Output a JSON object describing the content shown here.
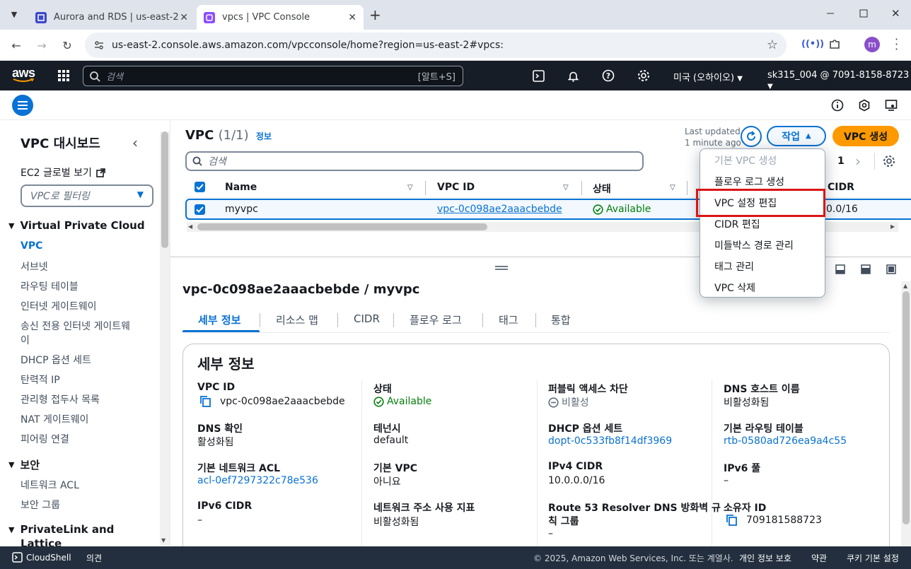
{
  "browser": {
    "tabs": [
      {
        "title": "Aurora and RDS | us-east-2",
        "active": false
      },
      {
        "title": "vpcs | VPC Console",
        "active": true
      }
    ],
    "url": "us-east-2.console.aws.amazon.com/vpcconsole/home?region=us-east-2#vpcs:",
    "profile_initial": "m"
  },
  "aws_bar": {
    "logo": "aws",
    "search_placeholder": "검색",
    "search_shortcut": "[알트+S]",
    "region": "미국 (오하이오)",
    "account": "sk315_004 @ 7091-8158-8723"
  },
  "sidebar": {
    "title": "VPC 대시보드",
    "ec2_global": "EC2 글로벌 보기",
    "filter_placeholder": "VPC로 필터링",
    "section_vpc": "Virtual Private Cloud",
    "vpc_items": [
      "VPC",
      "서브넷",
      "라우팅 테이블",
      "인터넷 게이트웨이",
      "송신 전용 인터넷 게이트웨",
      "이",
      "DHCP 옵션 세트",
      "탄력적 IP",
      "관리형 접두사 목록",
      "NAT 게이트웨이",
      "피어링 연결"
    ],
    "section_security": "보안",
    "security_items": [
      "네트워크 ACL",
      "보안 그룹"
    ],
    "section_privatelink": "PrivateLink and",
    "section_privatelink_2": "Lattice"
  },
  "main": {
    "title": "VPC",
    "count": "(1/1)",
    "info": "정보",
    "last_updated_1": "Last updated",
    "last_updated_2": "1 minute ago",
    "actions": "작업",
    "create": "VPC 생성",
    "search_placeholder": "검색",
    "page": "1",
    "columns": [
      "Name",
      "VPC ID",
      "상태",
      "CIDR"
    ],
    "row": {
      "name": "myvpc",
      "vpc_id": "vpc-0c098ae2aaacbebde",
      "status": "Available",
      "cidr": "0.0/16"
    }
  },
  "dropdown": {
    "items": [
      "기본 VPC 생성",
      "플로우 로그 생성",
      "VPC 설정 편집",
      "CIDR 편집",
      "미들박스 경로 관리",
      "태그 관리",
      "VPC 삭제"
    ],
    "highlighted": "VPC 설정 편집"
  },
  "detail": {
    "title": "vpc-0c098ae2aaacbebde / myvpc",
    "tabs": [
      "세부 정보",
      "리소스 맵",
      "CIDR",
      "플로우 로그",
      "태그",
      "통합"
    ],
    "section_title": "세부 정보",
    "fields": {
      "vpc_id_label": "VPC ID",
      "vpc_id": "vpc-0c098ae2aaacbebde",
      "state_label": "상태",
      "state": "Available",
      "public_block_label": "퍼블릭 액세스 차단",
      "public_block": "비활성",
      "dns_host_label": "DNS 호스트 이름",
      "dns_host": "비활성화됨",
      "dns_res_label": "DNS 확인",
      "dns_res": "활성화됨",
      "tenancy_label": "테넌시",
      "tenancy": "default",
      "dhcp_label": "DHCP 옵션 세트",
      "dhcp": "dopt-0c533fb8f14df3969",
      "main_rt_label": "기본 라우팅 테이블",
      "main_rt": "rtb-0580ad726ea9a4c55",
      "acl_label": "기본 네트워크 ACL",
      "acl": "acl-0ef7297322c78e536",
      "default_vpc_label": "기본 VPC",
      "default_vpc": "아니요",
      "ipv4_label": "IPv4 CIDR",
      "ipv4": "10.0.0.0/16",
      "ipv6pool_label": "IPv6 풀",
      "ipv6pool": "–",
      "ipv6_label": "IPv6 CIDR",
      "ipv6": "–",
      "netaddr_label": "네트워크 주소 사용 지표",
      "netaddr": "비활성화됨",
      "r53_label_1": "Route 53 Resolver DNS 방화벽 규",
      "r53_label_2": "칙 그룹",
      "r53": "–",
      "owner_label": "소유자 ID",
      "owner": "709181588723"
    }
  },
  "footer": {
    "cloudshell": "CloudShell",
    "feedback": "의견",
    "copyright": "© 2025, Amazon Web Services, Inc. 또는 계열사.",
    "privacy": "개인 정보 보호",
    "terms": "약관",
    "cookies": "쿠키 기본 설정"
  },
  "colors": {
    "accent": "#0972d3",
    "orange": "#ff9900",
    "success": "#037f0c",
    "highlight": "#d91515"
  }
}
